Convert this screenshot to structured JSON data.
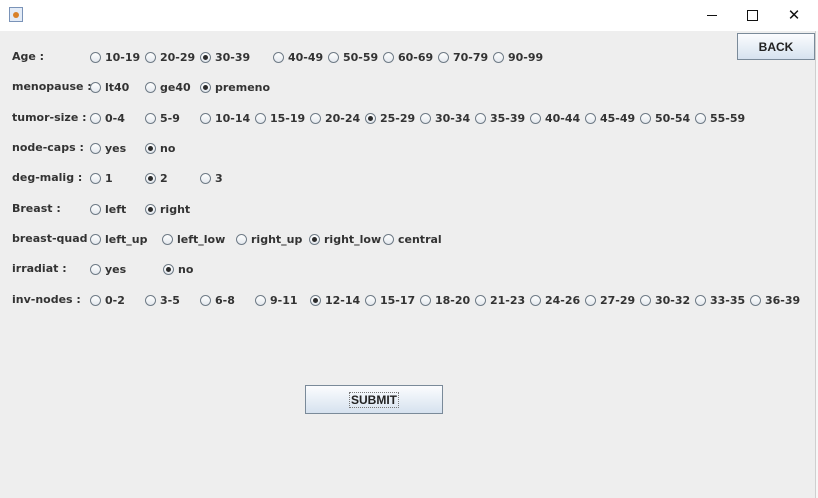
{
  "window": {
    "minimize_icon": "minimize-icon",
    "maximize_icon": "maximize-icon",
    "close_icon": "close-icon",
    "close_glyph": "✕"
  },
  "back_button": "BACK",
  "submit_button": "SUBMIT",
  "fields": [
    {
      "key": "age",
      "label": "Age :",
      "options": [
        "10-19",
        "20-29",
        "30-39",
        "40-49",
        "50-59",
        "60-69",
        "70-79",
        "90-99"
      ],
      "selected": "30-39"
    },
    {
      "key": "menopause",
      "label": "menopause :",
      "options": [
        "lt40",
        "ge40",
        "premeno"
      ],
      "selected": "premeno"
    },
    {
      "key": "tumor-size",
      "label": "tumor-size :",
      "options": [
        "0-4",
        "5-9",
        "10-14",
        "15-19",
        "20-24",
        "25-29",
        "30-34",
        "35-39",
        "40-44",
        "45-49",
        "50-54",
        "55-59"
      ],
      "selected": "25-29"
    },
    {
      "key": "node-caps",
      "label": "node-caps :",
      "options": [
        "yes",
        "no"
      ],
      "selected": "no"
    },
    {
      "key": "deg-malig",
      "label": "deg-malig :",
      "options": [
        "1",
        "2",
        "3"
      ],
      "selected": "2"
    },
    {
      "key": "breast",
      "label": "Breast :",
      "options": [
        "left",
        "right"
      ],
      "selected": "right"
    },
    {
      "key": "breast-quad",
      "label": "breast-quad :",
      "options": [
        "left_up",
        "left_low",
        "right_up",
        "right_low",
        "central"
      ],
      "selected": "right_low"
    },
    {
      "key": "irradiat",
      "label": "irradiat :",
      "options": [
        "yes",
        "no"
      ],
      "selected": "no"
    },
    {
      "key": "inv-nodes",
      "label": "inv-nodes :",
      "options": [
        "0-2",
        "3-5",
        "6-8",
        "9-11",
        "12-14",
        "15-17",
        "18-20",
        "21-23",
        "24-26",
        "27-29",
        "30-32",
        "33-35",
        "36-39"
      ],
      "selected": "12-14"
    }
  ]
}
